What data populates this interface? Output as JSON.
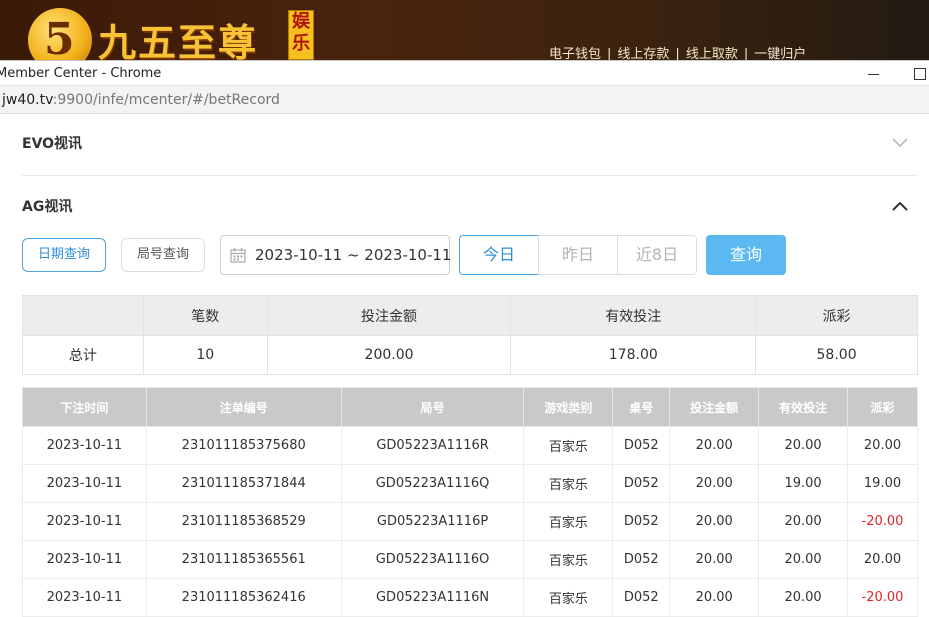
{
  "banner": {
    "logo_glyph": "5",
    "brand_name": "九五至尊",
    "brand_tag": "娱乐",
    "links": [
      "电子钱包",
      "线上存款",
      "线上取款",
      "一键归户"
    ],
    "separator": "|"
  },
  "window": {
    "title": "Member Center - Chrome"
  },
  "address_bar": {
    "host": "jw40.tv",
    "path": ":9900/infe/mcenter/#/betRecord"
  },
  "sections": {
    "evo": {
      "title": "EVO视讯",
      "state": "collapsed",
      "icon": "chevron-down-icon"
    },
    "ag": {
      "title": "AG视讯",
      "state": "expanded",
      "icon": "chevron-up-icon"
    }
  },
  "filters": {
    "date_query": "日期查询",
    "round_query": "局号查询",
    "date_range": "2023-10-11 ~ 2023-10-11",
    "quick": [
      "今日",
      "昨日",
      "近8日"
    ],
    "active_quick": "今日",
    "query_button": "查询"
  },
  "summary": {
    "headers": [
      "",
      "笔数",
      "投注金额",
      "有效投注",
      "派彩"
    ],
    "row": [
      "总计",
      "10",
      "200.00",
      "178.00",
      "58.00"
    ]
  },
  "records": {
    "headers": [
      "下注时间",
      "注单编号",
      "局号",
      "游戏类别",
      "桌号",
      "投注金额",
      "有效投注",
      "派彩"
    ],
    "rows": [
      [
        "2023-10-11",
        "231011185375680",
        "GD05223A1116R",
        "百家乐",
        "D052",
        "20.00",
        "20.00",
        "20.00"
      ],
      [
        "2023-10-11",
        "231011185371844",
        "GD05223A1116Q",
        "百家乐",
        "D052",
        "20.00",
        "19.00",
        "19.00"
      ],
      [
        "2023-10-11",
        "231011185368529",
        "GD05223A1116P",
        "百家乐",
        "D052",
        "20.00",
        "20.00",
        "-20.00"
      ],
      [
        "2023-10-11",
        "231011185365561",
        "GD05223A1116O",
        "百家乐",
        "D052",
        "20.00",
        "20.00",
        "20.00"
      ],
      [
        "2023-10-11",
        "231011185362416",
        "GD05223A1116N",
        "百家乐",
        "D052",
        "20.00",
        "20.00",
        "-20.00"
      ]
    ]
  },
  "colors": {
    "accent": "#2f8fd6",
    "query_button": "#5cb8f0",
    "negative": "#e0262b",
    "table_header": "#c9c9c9"
  }
}
